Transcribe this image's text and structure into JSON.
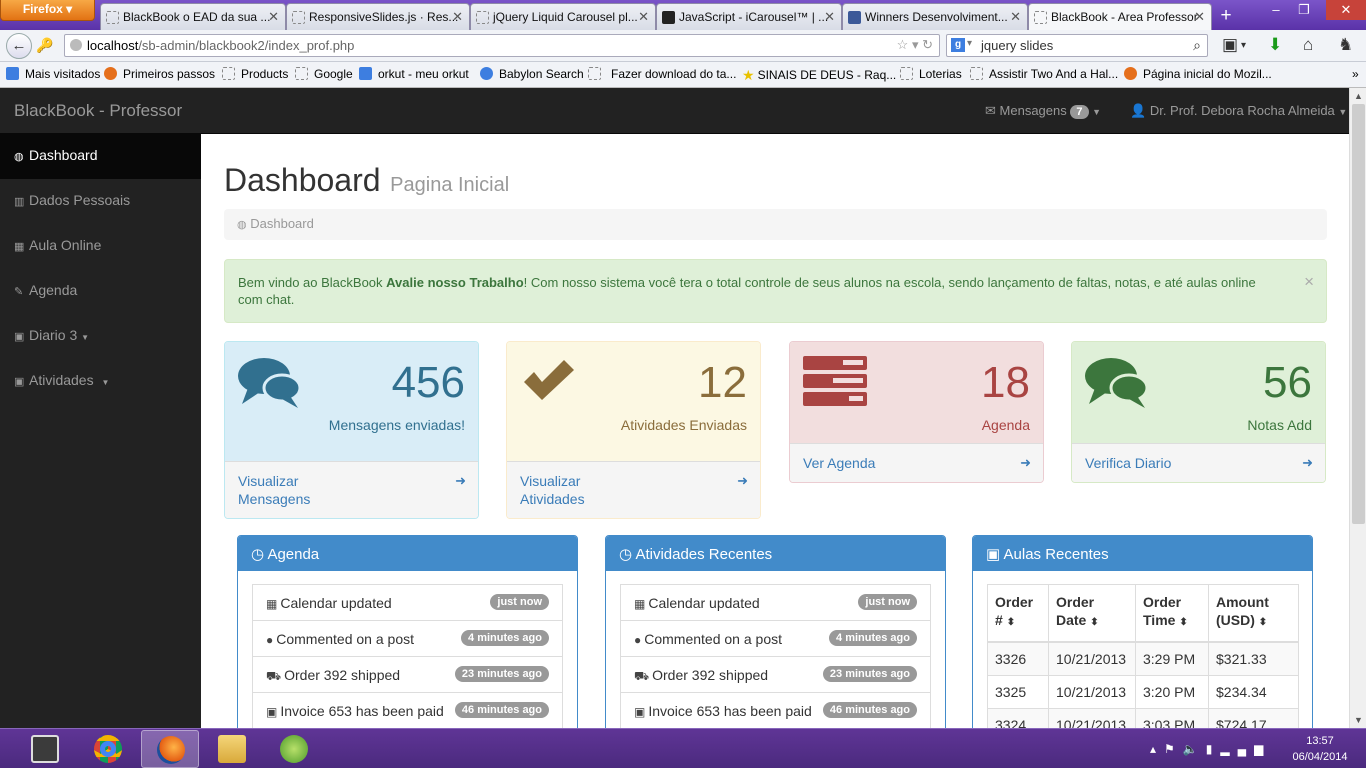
{
  "browser": {
    "menu_label": "Firefox",
    "tabs": [
      {
        "title": "BlackBook o EAD da sua ..."
      },
      {
        "title": "ResponsiveSlides.js · Res..."
      },
      {
        "title": "jQuery Liquid Carousel pl..."
      },
      {
        "title": "JavaScript - iCarousel™ | ..."
      },
      {
        "title": "Winners Desenvolviment..."
      },
      {
        "title": "BlackBook - Area Professor"
      }
    ],
    "url_host": "localhost",
    "url_path": "/sb-admin/blackbook2/index_prof.php",
    "search_value": "jquery slides",
    "bookmarks": [
      {
        "label": "Mais visitados"
      },
      {
        "label": "Primeiros passos"
      },
      {
        "label": "Products"
      },
      {
        "label": "Google"
      },
      {
        "label": "orkut - meu orkut"
      },
      {
        "label": "Babylon Search"
      },
      {
        "label": "Fazer download do ta..."
      },
      {
        "label": "SINAIS DE DEUS - Raq..."
      },
      {
        "label": "Loterias"
      },
      {
        "label": "Assistir Two And a Hal..."
      },
      {
        "label": "Página inicial do Mozil..."
      }
    ]
  },
  "app": {
    "brand": "BlackBook - Professor",
    "messages_label": "Mensagens",
    "messages_count": "7",
    "user_name": "Dr. Prof. Debora Rocha Almeida"
  },
  "sidebar": {
    "items": [
      {
        "label": "Dashboard",
        "icon": "dashboard-icon"
      },
      {
        "label": "Dados Pessoais",
        "icon": "bar-chart-icon"
      },
      {
        "label": "Aula Online",
        "icon": "table-icon"
      },
      {
        "label": "Agenda",
        "icon": "edit-icon"
      },
      {
        "label": "Diario 3",
        "icon": "caret-square-icon"
      },
      {
        "label": "Atividades",
        "icon": "caret-square-icon"
      }
    ]
  },
  "main": {
    "title": "Dashboard",
    "subtitle": "Pagina Inicial",
    "breadcrumb": "Dashboard",
    "alert": {
      "prefix": "Bem vindo ao BlackBook ",
      "bold": "Avalie nosso Trabalho",
      "suffix": "! Com nosso sistema você tera o total controle de seus alunos na escola, sendo lançamento de faltas, notas, e até aulas online com chat."
    },
    "stats": [
      {
        "value": "456",
        "label": "Mensagens enviadas!",
        "link": "Visualizar Mensagens",
        "color": "#31708f"
      },
      {
        "value": "12",
        "label": "Atividades Enviadas",
        "link": "Visualizar Atividades",
        "color": "#8a6d3b"
      },
      {
        "value": "18",
        "label": "Agenda",
        "link": "Ver Agenda",
        "color": "#a94442"
      },
      {
        "value": "56",
        "label": "Notas Add",
        "link": "Verifica Diario",
        "color": "#3c763d"
      }
    ],
    "agenda_panel": {
      "title": "Agenda",
      "items": [
        {
          "text": "Calendar updated",
          "time": "just now"
        },
        {
          "text": "Commented on a post",
          "time": "4 minutes ago"
        },
        {
          "text": "Order 392 shipped",
          "time": "23 minutes ago"
        },
        {
          "text": "Invoice 653 has been paid",
          "time": "46 minutes ago"
        }
      ]
    },
    "activities_panel": {
      "title": "Atividades Recentes",
      "items": [
        {
          "text": "Calendar updated",
          "time": "just now"
        },
        {
          "text": "Commented on a post",
          "time": "4 minutes ago"
        },
        {
          "text": "Order 392 shipped",
          "time": "23 minutes ago"
        },
        {
          "text": "Invoice 653 has been paid",
          "time": "46 minutes ago"
        }
      ]
    },
    "classes_panel": {
      "title": "Aulas Recentes",
      "columns": [
        "Order #",
        "Order Date",
        "Order Time",
        "Amount (USD)"
      ],
      "rows": [
        [
          "3326",
          "10/21/2013",
          "3:29 PM",
          "$321.33"
        ],
        [
          "3325",
          "10/21/2013",
          "3:20 PM",
          "$234.34"
        ],
        [
          "3324",
          "10/21/2013",
          "3:03 PM",
          "$724.17"
        ]
      ]
    }
  },
  "taskbar": {
    "time": "13:57",
    "date": "06/04/2014"
  }
}
